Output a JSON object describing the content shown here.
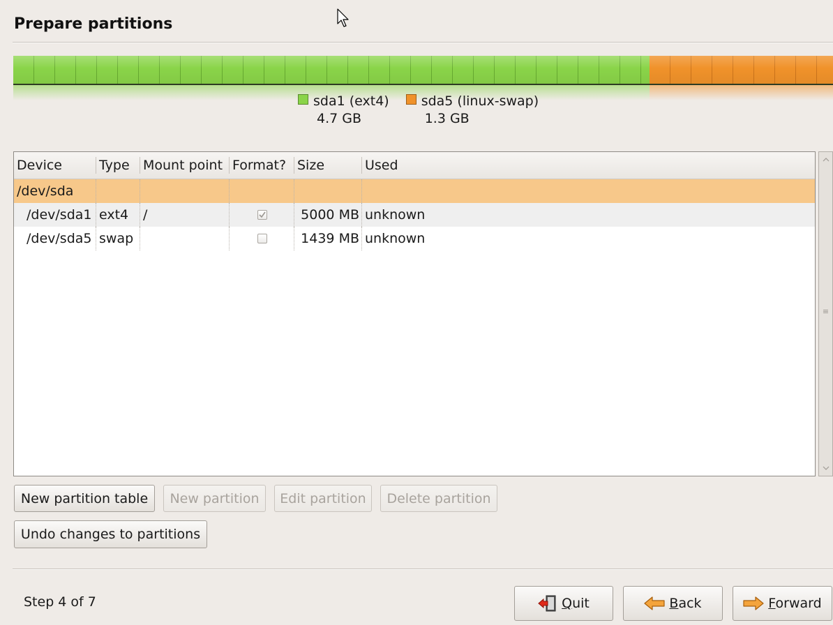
{
  "page": {
    "title": "Prepare partitions"
  },
  "partition_bar": {
    "segments": [
      {
        "name": "sda1 (ext4)",
        "size": "4.7 GB",
        "color": "#8ad449",
        "fraction": 0.7765
      },
      {
        "name": "sda5 (linux-swap)",
        "size": "1.3 GB",
        "color": "#f0922a",
        "fraction": 0.2235
      }
    ]
  },
  "table": {
    "columns": [
      "Device",
      "Type",
      "Mount point",
      "Format?",
      "Size",
      "Used"
    ],
    "rows": [
      {
        "device": "/dev/sda",
        "type": "",
        "mount": "",
        "format": null,
        "size": "",
        "used": "",
        "selected": true
      },
      {
        "device": "/dev/sda1",
        "type": "ext4",
        "mount": "/",
        "format": true,
        "size": "5000 MB",
        "used": "unknown"
      },
      {
        "device": "/dev/sda5",
        "type": "swap",
        "mount": "",
        "format": false,
        "size": "1439 MB",
        "used": "unknown"
      }
    ]
  },
  "buttons": {
    "new_table": "New partition table",
    "new_partition": "New partition",
    "edit_partition": "Edit partition",
    "delete_partition": "Delete partition",
    "undo": "Undo changes to partitions"
  },
  "footer": {
    "step": "Step 4 of 7",
    "quit_mnemonic": "Q",
    "quit_rest": "uit",
    "back_mnemonic": "B",
    "back_rest": "ack",
    "forward_mnemonic": "F",
    "forward_rest": "orward"
  },
  "icons": {
    "cursor": "mouse-pointer-icon",
    "quit": "exit-door-icon",
    "back": "arrow-left-icon",
    "forward": "arrow-right-icon"
  }
}
